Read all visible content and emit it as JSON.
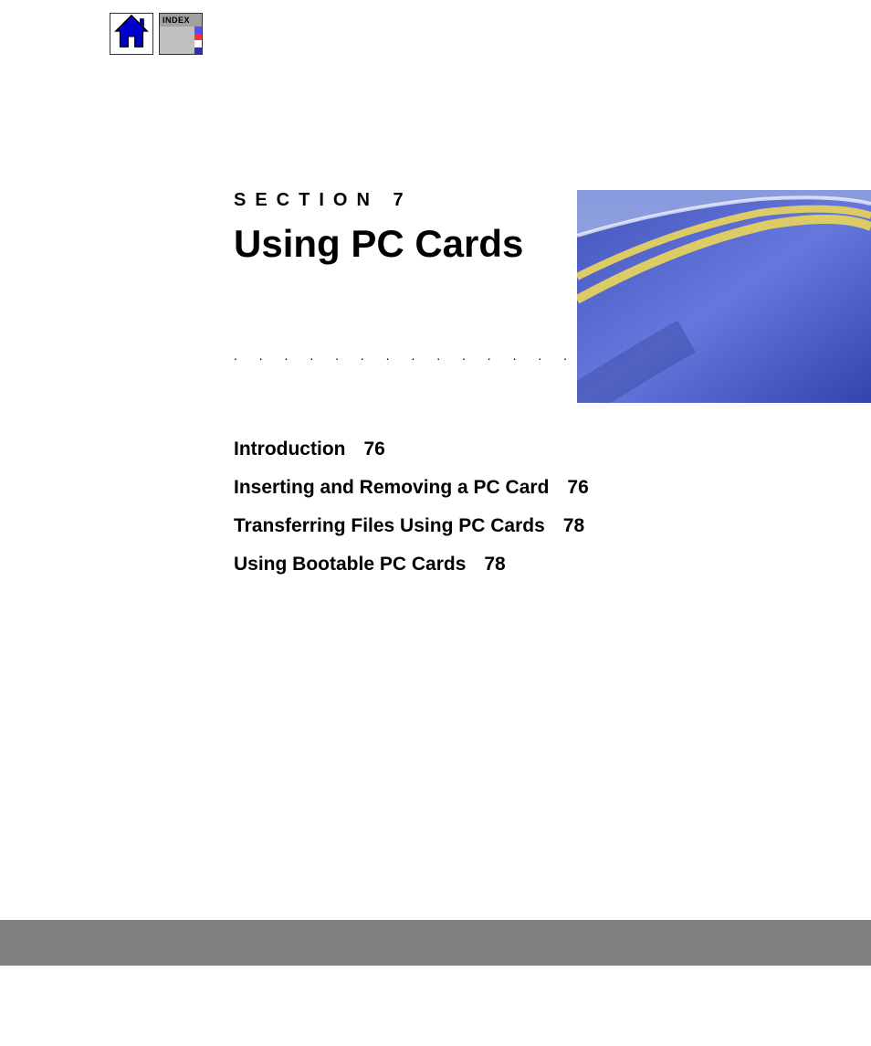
{
  "toolbar": {
    "home_icon": "home-icon",
    "index_icon": "index-icon",
    "index_label": "INDEX"
  },
  "header": {
    "section_label": "SECTION 7",
    "title": "Using PC Cards"
  },
  "toc": [
    {
      "title": "Introduction",
      "page": "76"
    },
    {
      "title": "Inserting and Removing a PC Card",
      "page": "76"
    },
    {
      "title": "Transferring Files Using PC Cards",
      "page": "78"
    },
    {
      "title": "Using Bootable PC Cards",
      "page": "78"
    }
  ],
  "dots": ". . . . . . . . . . . . . . . . . . . . . . . . . . . . ."
}
